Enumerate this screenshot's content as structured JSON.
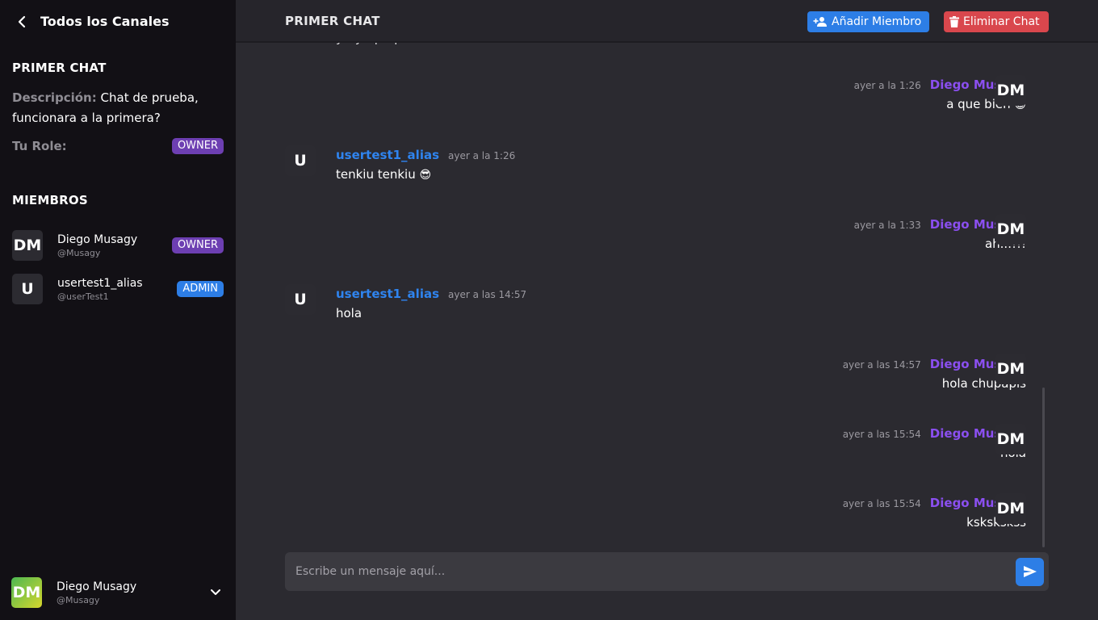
{
  "sidebar": {
    "back_title": "Todos los Canales",
    "chat_name": "PRIMER CHAT",
    "description_label": "Descripción:",
    "description_text": "Chat de prueba, funcionara a la primera?",
    "role_label": "Tu Role:",
    "role_value": "OWNER",
    "members_title": "MIEMBROS",
    "members": [
      {
        "initials": "DM",
        "name": "Diego Musagy",
        "handle": "@Musagy",
        "role": "OWNER"
      },
      {
        "initials": "U",
        "name": "usertest1_alias",
        "handle": "@userTest1",
        "role": "ADMIN"
      }
    ],
    "current_user": {
      "initials": "DM",
      "name": "Diego Musagy",
      "handle": "@Musagy"
    }
  },
  "topbar": {
    "title": "PRIMER CHAT",
    "add_member_label": "Añadir Miembro",
    "delete_chat_label": "Eliminar Chat"
  },
  "messages": [
    {
      "side": "left",
      "author": "",
      "time": "",
      "text": "y…y…p…p",
      "initials": ""
    },
    {
      "side": "right",
      "author": "Diego Musagy",
      "time": "ayer a la 1:26",
      "text": "a que bien",
      "emoji": "😀",
      "initials": "DM"
    },
    {
      "side": "left",
      "author": "usertest1_alias",
      "time": "ayer a la 1:26",
      "text": "tenkiu tenkiu",
      "emoji": "😎",
      "initials": "U"
    },
    {
      "side": "right",
      "author": "Diego Musagy",
      "time": "ayer a la 1:33",
      "text": "ah...!!!",
      "initials": "DM"
    },
    {
      "side": "left",
      "author": "usertest1_alias",
      "time": "ayer a las 14:57",
      "text": "hola",
      "initials": "U"
    },
    {
      "side": "right",
      "author": "Diego Musagy",
      "time": "ayer a las 14:57",
      "text": "hola chupapis",
      "initials": "DM"
    },
    {
      "side": "right",
      "author": "Diego Musagy",
      "time": "ayer a las 15:54",
      "text": "hola",
      "initials": "DM"
    },
    {
      "side": "right",
      "author": "Diego Musagy",
      "time": "ayer a las 15:54",
      "text": "kskskskss",
      "initials": "DM"
    }
  ],
  "composer": {
    "placeholder": "Escribe un mensaje aquí..."
  },
  "colors": {
    "accent_blue": "#2d7ee6",
    "danger_red": "#d9474d",
    "owner_purple": "#6d3fb2",
    "name_purple": "#8b4ff0",
    "name_blue": "#2f84ef"
  },
  "icons": {
    "back": "chevron-left-icon",
    "add_member": "person-add-icon",
    "delete": "trash-icon",
    "send": "send-icon",
    "account_menu": "chevron-down-icon"
  }
}
